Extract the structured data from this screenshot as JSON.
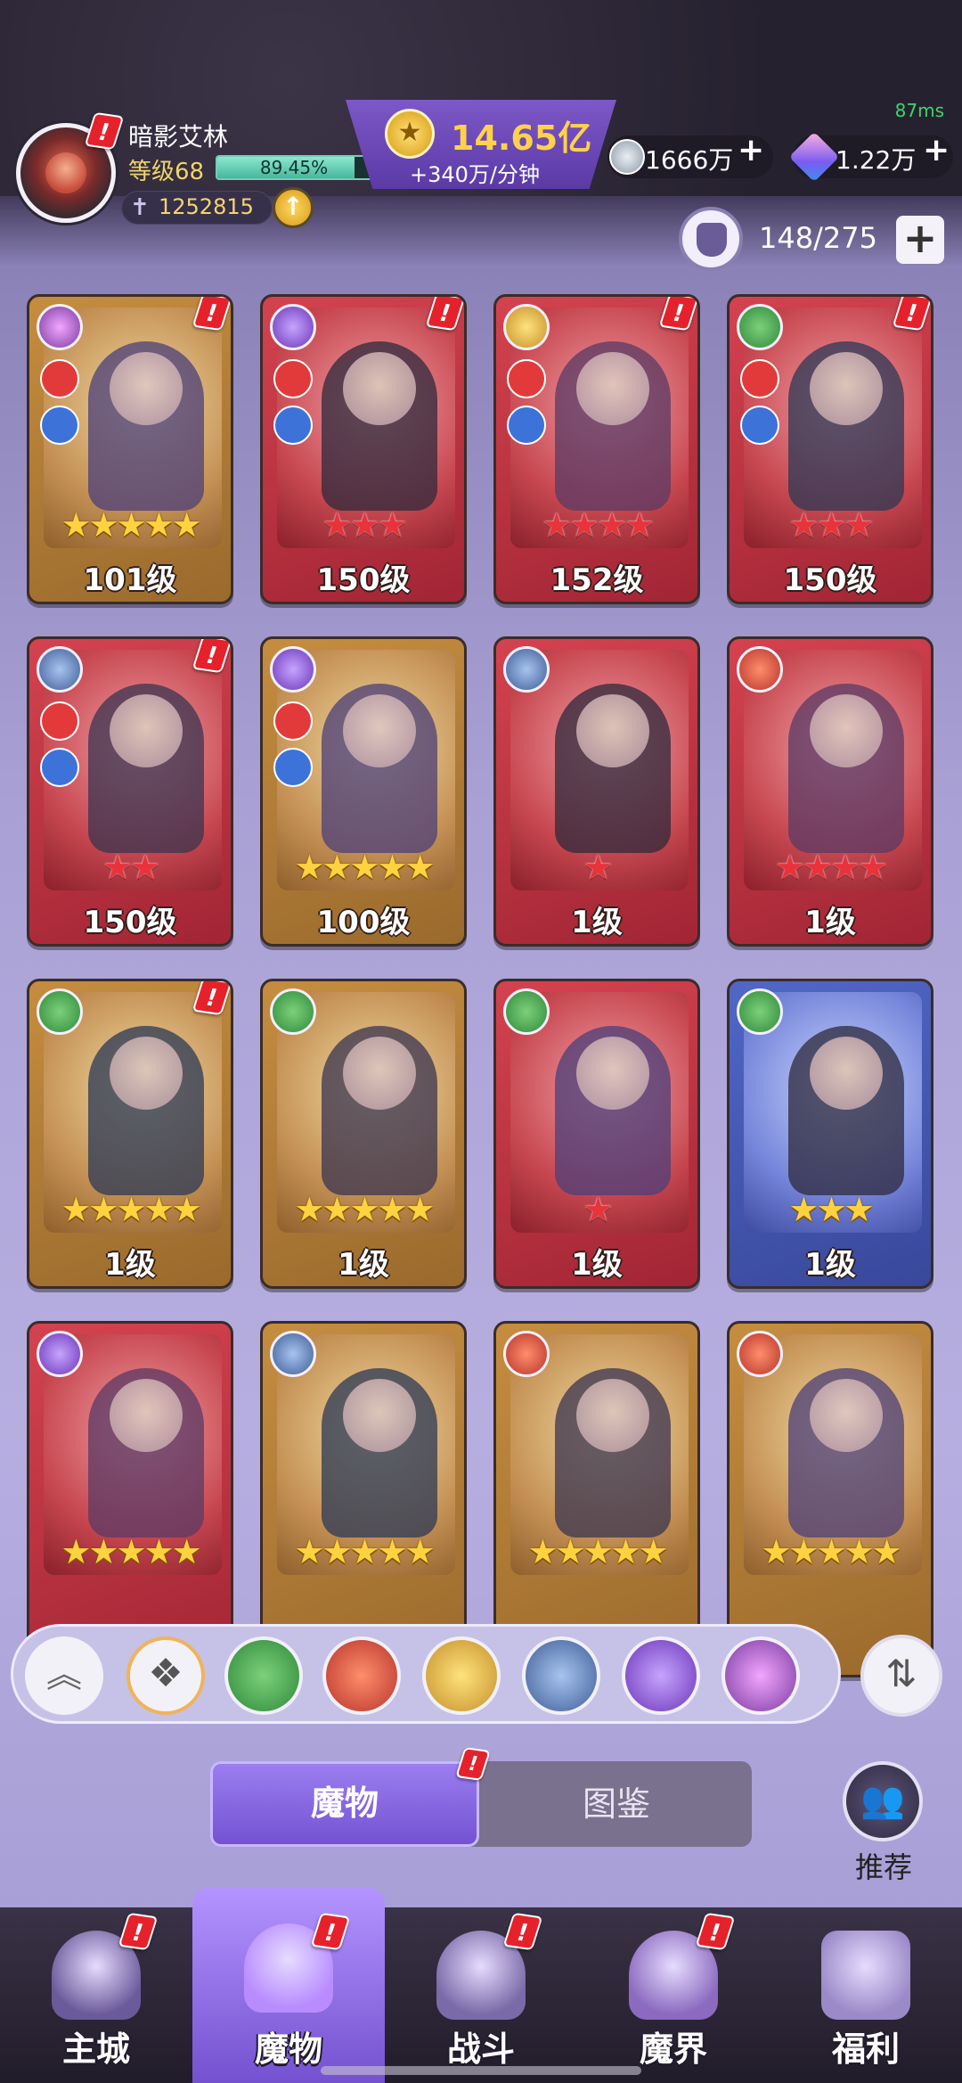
{
  "status": {
    "ping": "87ms"
  },
  "player": {
    "name": "暗影艾林",
    "level_label": "等级68",
    "xp_percent_text": "89.45%",
    "xp_fraction": 0.8945,
    "power": "1252815",
    "upgrade_icon": "arrow-up-icon"
  },
  "currency": {
    "gold": "14.65亿",
    "gold_rate": "+340万/分钟",
    "silver": "1666万",
    "crystal": "1.22万",
    "add_symbol": "+"
  },
  "capacity": {
    "text": "148/275",
    "add_symbol": "+"
  },
  "colors": {
    "accent": "#7452d2",
    "gold": "#ffd24a",
    "alert": "#e5222c",
    "ping": "#39d66b"
  },
  "cards": [
    {
      "frame": "gold",
      "faction": "chaos",
      "roles": true,
      "badge": true,
      "stars": 5,
      "star_color": "gold",
      "level": "101级"
    },
    {
      "frame": "red",
      "faction": "abyss",
      "roles": true,
      "badge": true,
      "stars": 3,
      "star_color": "red",
      "level": "150级"
    },
    {
      "frame": "red",
      "faction": "time",
      "roles": true,
      "badge": true,
      "stars": 4,
      "star_color": "red",
      "level": "152级"
    },
    {
      "frame": "red",
      "faction": "forest",
      "roles": true,
      "badge": true,
      "stars": 3,
      "star_color": "red",
      "level": "150级"
    },
    {
      "frame": "red",
      "faction": "dragon",
      "roles": true,
      "badge": true,
      "stars": 2,
      "star_color": "red",
      "level": "150级"
    },
    {
      "frame": "gold",
      "faction": "abyss",
      "roles": true,
      "badge": false,
      "stars": 5,
      "star_color": "gold",
      "level": "100级"
    },
    {
      "frame": "red",
      "faction": "dragon",
      "roles": false,
      "badge": false,
      "stars": 1,
      "star_color": "red",
      "level": "1级"
    },
    {
      "frame": "red",
      "faction": "demon",
      "roles": false,
      "badge": false,
      "stars": 4,
      "star_color": "red",
      "level": "1级"
    },
    {
      "frame": "gold",
      "faction": "forest",
      "roles": false,
      "badge": true,
      "stars": 5,
      "star_color": "gold",
      "level": "1级"
    },
    {
      "frame": "gold",
      "faction": "forest",
      "roles": false,
      "badge": false,
      "stars": 5,
      "star_color": "gold",
      "level": "1级"
    },
    {
      "frame": "red",
      "faction": "forest",
      "roles": false,
      "badge": false,
      "stars": 1,
      "star_color": "red",
      "level": "1级"
    },
    {
      "frame": "blue",
      "faction": "forest",
      "roles": false,
      "badge": false,
      "stars": 3,
      "star_color": "gold",
      "level": "1级"
    },
    {
      "frame": "red",
      "faction": "abyss",
      "roles": false,
      "badge": false,
      "stars": 5,
      "star_color": "gold",
      "level": ""
    },
    {
      "frame": "gold",
      "faction": "dragon",
      "roles": false,
      "badge": false,
      "stars": 5,
      "star_color": "gold",
      "level": ""
    },
    {
      "frame": "gold",
      "faction": "demon",
      "roles": false,
      "badge": false,
      "stars": 5,
      "star_color": "gold",
      "level": ""
    },
    {
      "frame": "gold",
      "faction": "demon",
      "roles": false,
      "badge": false,
      "stars": 5,
      "star_color": "gold",
      "level": ""
    }
  ],
  "filters": [
    {
      "name": "collapse",
      "icon": "double-chevron-up-icon"
    },
    {
      "name": "all",
      "icon": "diamond-grid-icon"
    },
    {
      "name": "forest",
      "icon": "leaf-icon"
    },
    {
      "name": "demon",
      "icon": "demon-mask-icon"
    },
    {
      "name": "time",
      "icon": "hourglass-icon"
    },
    {
      "name": "dragon",
      "icon": "dragon-icon"
    },
    {
      "name": "abyss",
      "icon": "eye-icon"
    },
    {
      "name": "chaos",
      "icon": "swirl-icon"
    }
  ],
  "tabs": {
    "active": "魔物",
    "inactive": "图鉴"
  },
  "recommend": {
    "label": "推荐"
  },
  "nav": [
    {
      "label": "主城",
      "icon": "castle-icon",
      "active": false,
      "badge": true
    },
    {
      "label": "魔物",
      "icon": "monster-flame-icon",
      "active": true,
      "badge": true
    },
    {
      "label": "战斗",
      "icon": "sword-shield-icon",
      "active": false,
      "badge": true
    },
    {
      "label": "魔界",
      "icon": "portal-icon",
      "active": false,
      "badge": true
    },
    {
      "label": "福利",
      "icon": "treasure-chest-icon",
      "active": false,
      "badge": false
    }
  ]
}
